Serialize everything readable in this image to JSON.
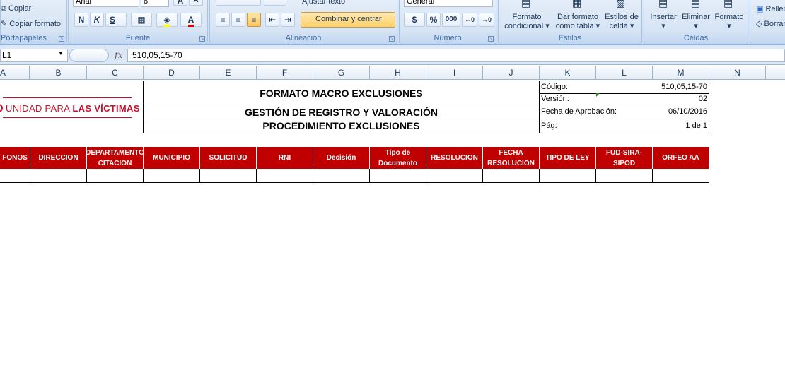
{
  "ribbon": {
    "portapapeles": {
      "label": "Portapapeles",
      "copiar": "Copiar",
      "copiar_formato": "Copiar formato"
    },
    "fuente": {
      "label": "Fuente",
      "font_name": "Arial",
      "font_size": "8",
      "bold": "N",
      "italic": "K",
      "underline": "S"
    },
    "alineacion": {
      "label": "Alineación",
      "ajustar_texto": "Ajustar texto",
      "combinar": "Combinar y centrar"
    },
    "numero": {
      "label": "Número",
      "format": "General",
      "currency": "$",
      "percent": "%",
      "thousands": "000"
    },
    "estilos": {
      "label": "Estilos",
      "formato_condicional_1": "Formato",
      "formato_condicional_2": "condicional",
      "dar_formato_1": "Dar formato",
      "dar_formato_2": "como tabla",
      "estilos_celda_1": "Estilos de",
      "estilos_celda_2": "celda"
    },
    "celdas": {
      "label": "Celdas",
      "insertar": "Insertar",
      "eliminar": "Eliminar",
      "formato": "Formato"
    },
    "modificar": {
      "rellenar": "Rellenar",
      "borrar": "Borrar"
    }
  },
  "formula_bar": {
    "name_box": "L1",
    "fx": "fx",
    "value": "510,05,15-70"
  },
  "columns": [
    "A",
    "B",
    "C",
    "D",
    "E",
    "F",
    "G",
    "H",
    "I",
    "J",
    "K",
    "L",
    "M",
    "N"
  ],
  "logo": {
    "prefix": "UNIDAD PARA",
    "emphasis": "LAS VÍCTIMAS"
  },
  "header": {
    "title1": "FORMATO MACRO EXCLUSIONES",
    "title2": "GESTIÓN DE REGISTRO Y VALORACIÓN",
    "title3": "PROCEDIMIENTO EXCLUSIONES"
  },
  "meta": {
    "codigo_label": "Código:",
    "codigo_value": "510,05,15-70",
    "version_label": "Versión:",
    "version_value": "02",
    "fecha_label": "Fecha de Aprobación:",
    "fecha_value": "06/10/2016",
    "pag_label": "Pág:",
    "pag_value": "1 de 1"
  },
  "table_headers": [
    "FONOS",
    "DIRECCION",
    "DEPARTAMENTO CITACION",
    "MUNICIPIO",
    "SOLICITUD",
    "RNI",
    "Decisión",
    "Tipo de Documento",
    "RESOLUCION",
    "FECHA RESOLUCION",
    "TIPO DE LEY",
    "FUD-SIRA-SIPOD",
    "ORFEO AA"
  ],
  "colors": {
    "header_red": "#c00000",
    "logo_red": "#c8102e",
    "ribbon_blue": "#dfe9f5"
  }
}
